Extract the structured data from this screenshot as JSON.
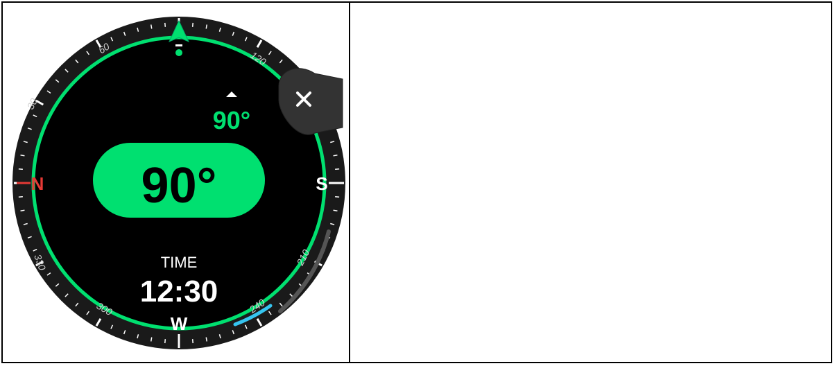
{
  "watch": {
    "heading_value": "90°",
    "target_value": "90°",
    "time_label": "TIME",
    "time_value": "12:30",
    "cardinals": {
      "north": "N",
      "south": "S",
      "west": "W"
    },
    "bezel_numbers": [
      "60",
      "120",
      "30",
      "330",
      "300",
      "240",
      "210"
    ],
    "close_icon": "close-icon",
    "colors": {
      "accent": "#00e070",
      "north": "#e53935",
      "cyan_marker": "#36c5f0",
      "bezel": "#1a1a1a",
      "face": "#000000"
    }
  }
}
